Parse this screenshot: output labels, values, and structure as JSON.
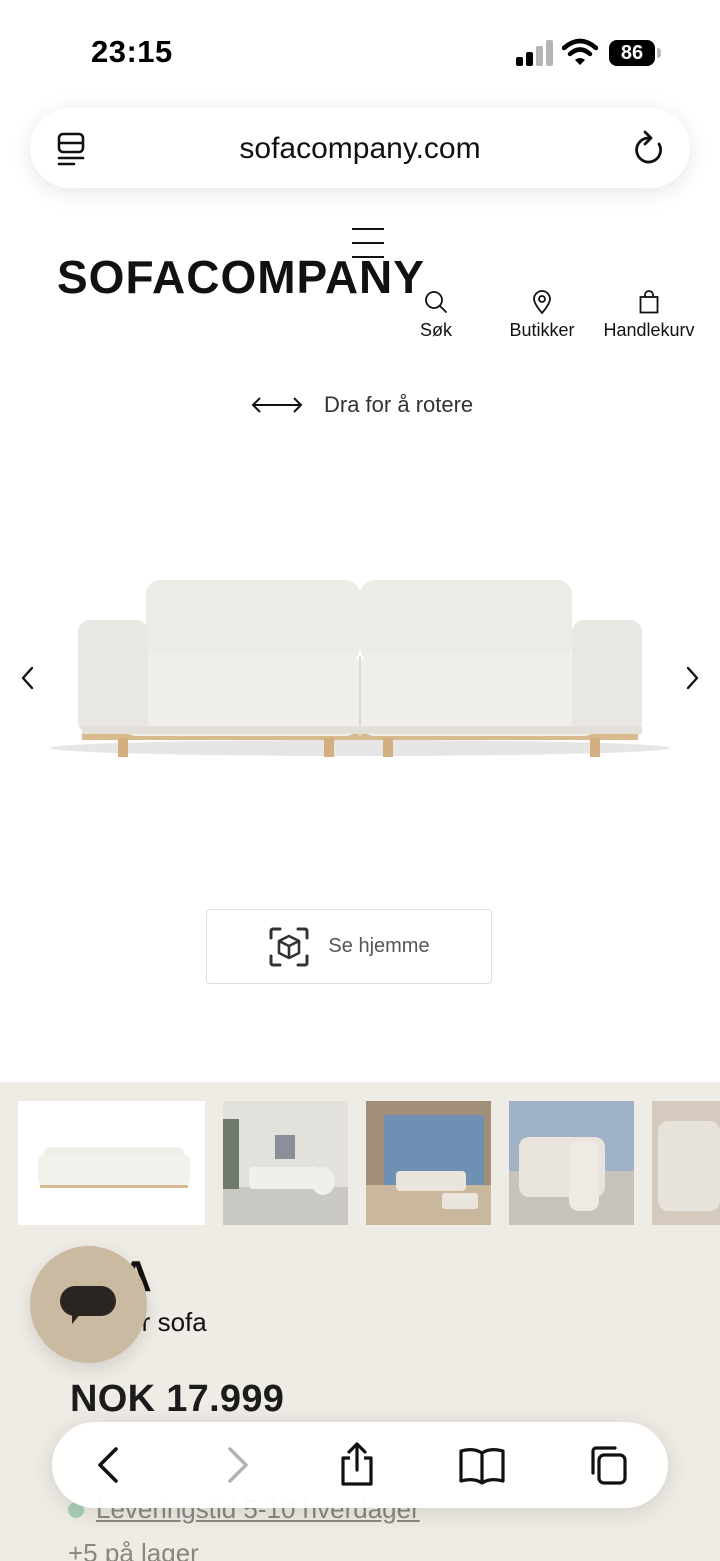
{
  "status_bar": {
    "time": "23:15",
    "battery": "86"
  },
  "browser": {
    "url": "sofacompany.com"
  },
  "header": {
    "logo": "SOFACOMPANY",
    "nav": [
      {
        "label": "Søk",
        "icon": "search-icon"
      },
      {
        "label": "Butikker",
        "icon": "location-pin-icon"
      },
      {
        "label": "Handlekurv",
        "icon": "shopping-bag-icon"
      }
    ]
  },
  "viewer": {
    "rotate_hint": "Dra for å rotere",
    "ar_button": "Se hjemme"
  },
  "product": {
    "title": "A",
    "subtitle": "ter sofa",
    "price": "NOK 17.999",
    "delivery": "Leveringstid 5-10 hverdager",
    "stock": "+5 på lager"
  },
  "colors": {
    "beige_background": "#efebe5",
    "chat_button": "#c9baa1",
    "in_stock_dot": "#a9cfb6"
  }
}
